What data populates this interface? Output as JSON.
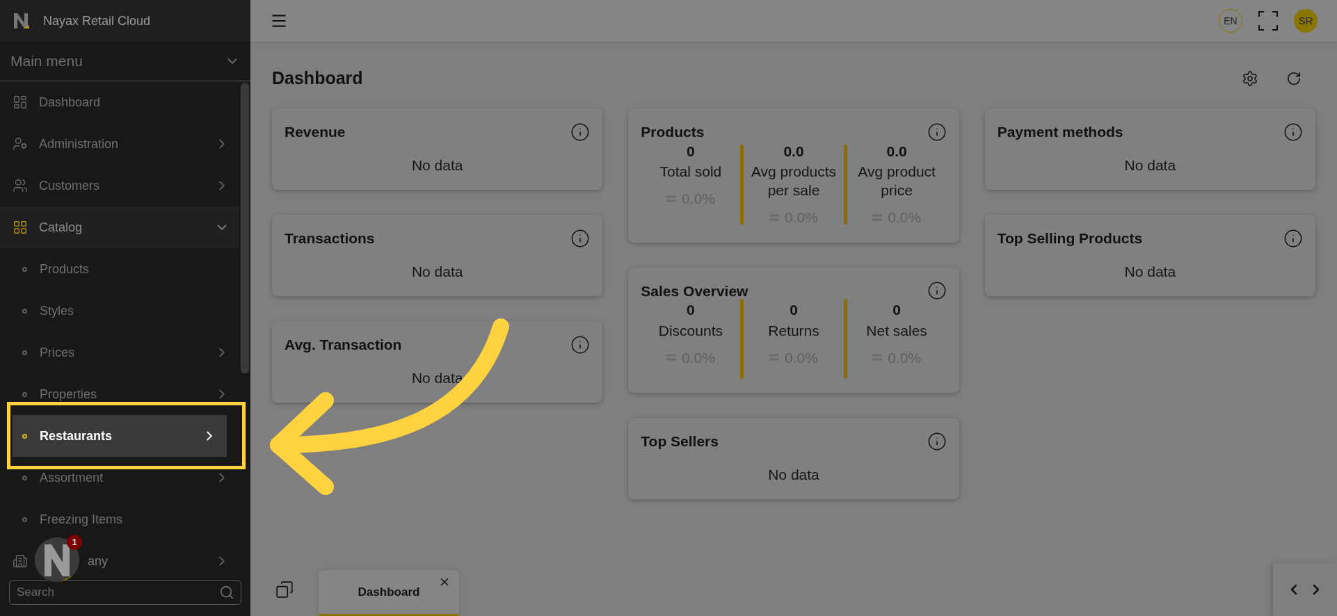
{
  "app": {
    "title": "Nayax Retail Cloud"
  },
  "menu": {
    "title": "Main menu",
    "items": [
      {
        "label": "Dashboard",
        "has_children": false,
        "expanded": false
      },
      {
        "label": "Administration",
        "has_children": true,
        "expanded": false
      },
      {
        "label": "Customers",
        "has_children": true,
        "expanded": false
      },
      {
        "label": "Catalog",
        "has_children": true,
        "expanded": true,
        "children": [
          {
            "label": "Products",
            "has_children": false,
            "selected": false
          },
          {
            "label": "Styles",
            "has_children": false,
            "selected": false
          },
          {
            "label": "Prices",
            "has_children": true,
            "selected": false
          },
          {
            "label": "Properties",
            "has_children": true,
            "selected": false
          },
          {
            "label": "Restaurants",
            "has_children": true,
            "selected": true
          },
          {
            "label": "Assortment",
            "has_children": true,
            "selected": false
          },
          {
            "label": "Freezing Items",
            "has_children": false,
            "selected": false
          }
        ]
      },
      {
        "label": "any",
        "has_children": true,
        "expanded": false
      }
    ]
  },
  "search": {
    "placeholder": "Search"
  },
  "assistant": {
    "badge": "1"
  },
  "header": {
    "language": "EN",
    "user": "SR"
  },
  "page": {
    "title": "Dashboard"
  },
  "columns": [
    [
      {
        "kind": "empty",
        "title": "Revenue",
        "message": "No data"
      },
      {
        "kind": "empty",
        "title": "Transactions",
        "message": "No data"
      },
      {
        "kind": "empty",
        "title": "Avg. Transaction",
        "message": "No data"
      }
    ],
    [
      {
        "kind": "metrics",
        "title": "Products",
        "metrics": [
          {
            "value": "0",
            "label": "Total sold",
            "change": "0.0%"
          },
          {
            "value": "0.0",
            "label": "Avg products per sale",
            "change": "0.0%"
          },
          {
            "value": "0.0",
            "label": "Avg product price",
            "change": "0.0%"
          }
        ]
      },
      {
        "kind": "metrics",
        "title": "Sales Overview",
        "metrics": [
          {
            "value": "0",
            "label": "Discounts",
            "change": "0.0%"
          },
          {
            "value": "0",
            "label": "Returns",
            "change": "0.0%"
          },
          {
            "value": "0",
            "label": "Net sales",
            "change": "0.0%"
          }
        ]
      },
      {
        "kind": "empty",
        "title": "Top Sellers",
        "message": "No data"
      }
    ],
    [
      {
        "kind": "empty",
        "title": "Payment methods",
        "message": "No data"
      },
      {
        "kind": "empty",
        "title": "Top Selling Products",
        "message": "No data"
      }
    ]
  ],
  "tabs": [
    {
      "label": "Dashboard",
      "selected": true
    }
  ]
}
